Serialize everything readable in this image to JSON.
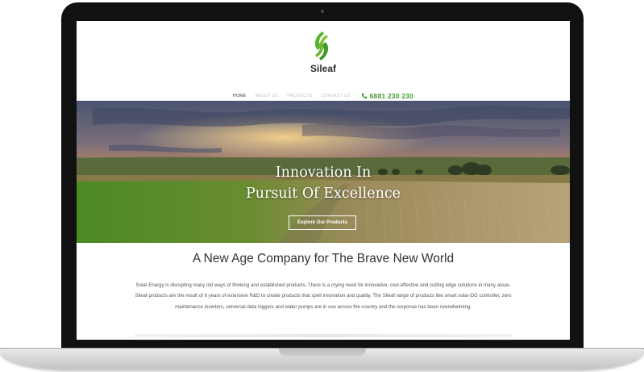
{
  "site": {
    "brand": "Sileaf",
    "colors": {
      "accent": "#4caf2e",
      "accent_dark": "#2f8f1e",
      "text": "#333333"
    }
  },
  "nav": {
    "items": [
      {
        "label": "HOME",
        "active": true
      },
      {
        "label": "ABOUT US",
        "active": false
      },
      {
        "label": "PRODUCTS",
        "active": false
      },
      {
        "label": "CONTACT US",
        "active": false
      }
    ],
    "phone_icon": "phone-icon",
    "phone": "6881 230 230"
  },
  "hero": {
    "line1": "Innovation In",
    "line2": "Pursuit Of Excellence",
    "cta_label": "Explore Our Products"
  },
  "intro": {
    "title": "A New Age Company for The Brave New World",
    "body": "Solar Energy is disrupting many old ways of thinking and established products. There is a crying need for innovative, cost-effective and cutting edge solutions in many areas. Sileaf products are the result of 6 years of extensive R&D to create products that spell innovation and quality. The Sileaf range of products like smart solar-DG controller, zero maintenance inverters, universal data loggers and water pumps are in use across the country and the response has been overwhelming."
  }
}
